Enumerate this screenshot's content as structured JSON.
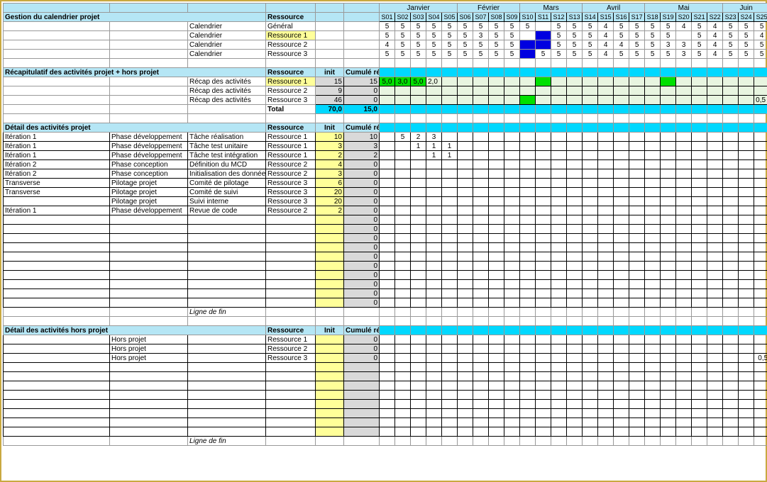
{
  "months": [
    "Janvier",
    "Février",
    "Mars",
    "Avril",
    "Mai",
    "Juin"
  ],
  "month_spans": [
    5,
    4,
    4,
    4,
    5,
    3
  ],
  "weeks": [
    "S01",
    "S02",
    "S03",
    "S04",
    "S05",
    "S06",
    "S07",
    "S08",
    "S09",
    "S10",
    "S11",
    "S12",
    "S13",
    "S14",
    "S15",
    "S16",
    "S17",
    "S18",
    "S19",
    "S20",
    "S21",
    "S22",
    "S23",
    "S24",
    "S25"
  ],
  "section1": {
    "title": "Gestion du calendrier projet",
    "res_label": "Ressource",
    "rows": [
      {
        "cat": "Calendrier",
        "res": "Général",
        "vals": [
          "5",
          "5",
          "5",
          "5",
          "5",
          "5",
          "5",
          "5",
          "5",
          "5",
          "",
          "5",
          "5",
          "5",
          "4",
          "5",
          "5",
          "5",
          "5",
          "4",
          "5",
          "4",
          "5",
          "5",
          "5"
        ]
      },
      {
        "cat": "Calendrier",
        "res": "Ressource 1",
        "vals": [
          "5",
          "5",
          "5",
          "5",
          "5",
          "5",
          "3",
          "5",
          "5",
          "",
          "",
          "5",
          "5",
          "5",
          "4",
          "5",
          "5",
          "5",
          "5",
          "",
          "5",
          "4",
          "5",
          "5",
          "4"
        ],
        "hl": true,
        "blue": [
          10
        ]
      },
      {
        "cat": "Calendrier",
        "res": "Ressource 2",
        "vals": [
          "4",
          "5",
          "5",
          "5",
          "5",
          "5",
          "5",
          "5",
          "5",
          "",
          "",
          "5",
          "5",
          "5",
          "4",
          "4",
          "5",
          "5",
          "3",
          "3",
          "5",
          "4",
          "5",
          "5",
          "5"
        ],
        "blue": [
          9,
          10
        ]
      },
      {
        "cat": "Calendrier",
        "res": "Ressource 3",
        "vals": [
          "5",
          "5",
          "5",
          "5",
          "5",
          "5",
          "5",
          "5",
          "5",
          "",
          "5",
          "5",
          "5",
          "5",
          "4",
          "5",
          "5",
          "5",
          "5",
          "3",
          "5",
          "4",
          "5",
          "5",
          "5"
        ],
        "blue": [
          9
        ]
      }
    ]
  },
  "section2": {
    "title": "Récapitulatif des activités projet + hors projet",
    "res_label": "Ressource",
    "init": "init",
    "cumul": "Cumulé réactua.",
    "rows": [
      {
        "cat": "Récap des activités",
        "res": "Ressource 1",
        "init": "15",
        "cumul": "15",
        "hl": true,
        "cells": [
          {
            "i": 0,
            "v": "5,0",
            "c": "green"
          },
          {
            "i": 1,
            "v": "3,0",
            "c": "green"
          },
          {
            "i": 2,
            "v": "5,0",
            "c": "green"
          },
          {
            "i": 3,
            "v": "2,0"
          },
          {
            "i": 10,
            "c": "green"
          },
          {
            "i": 18,
            "c": "green"
          }
        ]
      },
      {
        "cat": "Récap des activités",
        "res": "Ressource 2",
        "init": "9",
        "cumul": "0",
        "cells": []
      },
      {
        "cat": "Récap des activités",
        "res": "Ressource 3",
        "init": "46",
        "cumul": "0",
        "cells": [
          {
            "i": 9,
            "c": "green"
          },
          {
            "i": 24,
            "v": "0,5"
          }
        ]
      }
    ],
    "total_label": "Total",
    "total_init": "70,0",
    "total_cumul": "15,0"
  },
  "section3": {
    "title": "Détail des activités projet",
    "res_label": "Ressource",
    "init": "Init",
    "cumul": "Cumulé réactua.",
    "rows": [
      {
        "a": "Itération 1",
        "b": "Phase développement",
        "c": "Tâche réalisation",
        "d": "Ressource 1",
        "init": "10",
        "cumul": "10",
        "cells": {
          "1": "5",
          "2": "2",
          "3": "3"
        }
      },
      {
        "a": "Itération 1",
        "b": "Phase développement",
        "c": "Tâche test unitaire",
        "d": "Ressource 1",
        "init": "3",
        "cumul": "3",
        "cells": {
          "2": "1",
          "3": "1",
          "4": "1"
        }
      },
      {
        "a": "Itération 1",
        "b": "Phase développement",
        "c": "Tâche test intégration",
        "d": "Ressource 1",
        "init": "2",
        "cumul": "2",
        "cells": {
          "3": "1",
          "4": "1"
        }
      },
      {
        "a": "Itération 2",
        "b": "Phase conception",
        "c": "Définition du MCD",
        "d": "Ressource 2",
        "init": "4",
        "cumul": "0",
        "cells": {}
      },
      {
        "a": "Itération 2",
        "b": "Phase conception",
        "c": "Initialisation des données",
        "d": "Ressource 2",
        "init": "3",
        "cumul": "0",
        "cells": {}
      },
      {
        "a": "Transverse",
        "b": "Pilotage projet",
        "c": "Comité de pilotage",
        "d": "Ressource 3",
        "init": "6",
        "cumul": "0",
        "cells": {}
      },
      {
        "a": "Transverse",
        "b": "Pilotage projet",
        "c": "Comité de suivi",
        "d": "Ressource 3",
        "init": "20",
        "cumul": "0",
        "cells": {}
      },
      {
        "a": "",
        "b": "Pilotage projet",
        "c": "Suivi interne",
        "d": "Ressource 3",
        "init": "20",
        "cumul": "0",
        "cells": {}
      },
      {
        "a": "Itération 1",
        "b": "Phase développement",
        "c": "Revue de code",
        "d": "Ressource 2",
        "init": "2",
        "cumul": "0",
        "cells": {}
      }
    ],
    "empty_rows": 10,
    "ligne_fin": "Ligne de fin"
  },
  "section4": {
    "title": "Détail des activités hors projet",
    "res_label": "Ressource",
    "init": "Init",
    "cumul": "Cumulé réactua.",
    "rows": [
      {
        "b": "Hors projet",
        "d": "Ressource 1",
        "cumul": "0"
      },
      {
        "b": "Hors projet",
        "d": "Ressource 2",
        "cumul": "0"
      },
      {
        "b": "Hors projet",
        "d": "Ressource 3",
        "cumul": "0",
        "last": "0,5"
      }
    ],
    "empty_rows": 8,
    "ligne_fin": "Ligne de fin"
  }
}
